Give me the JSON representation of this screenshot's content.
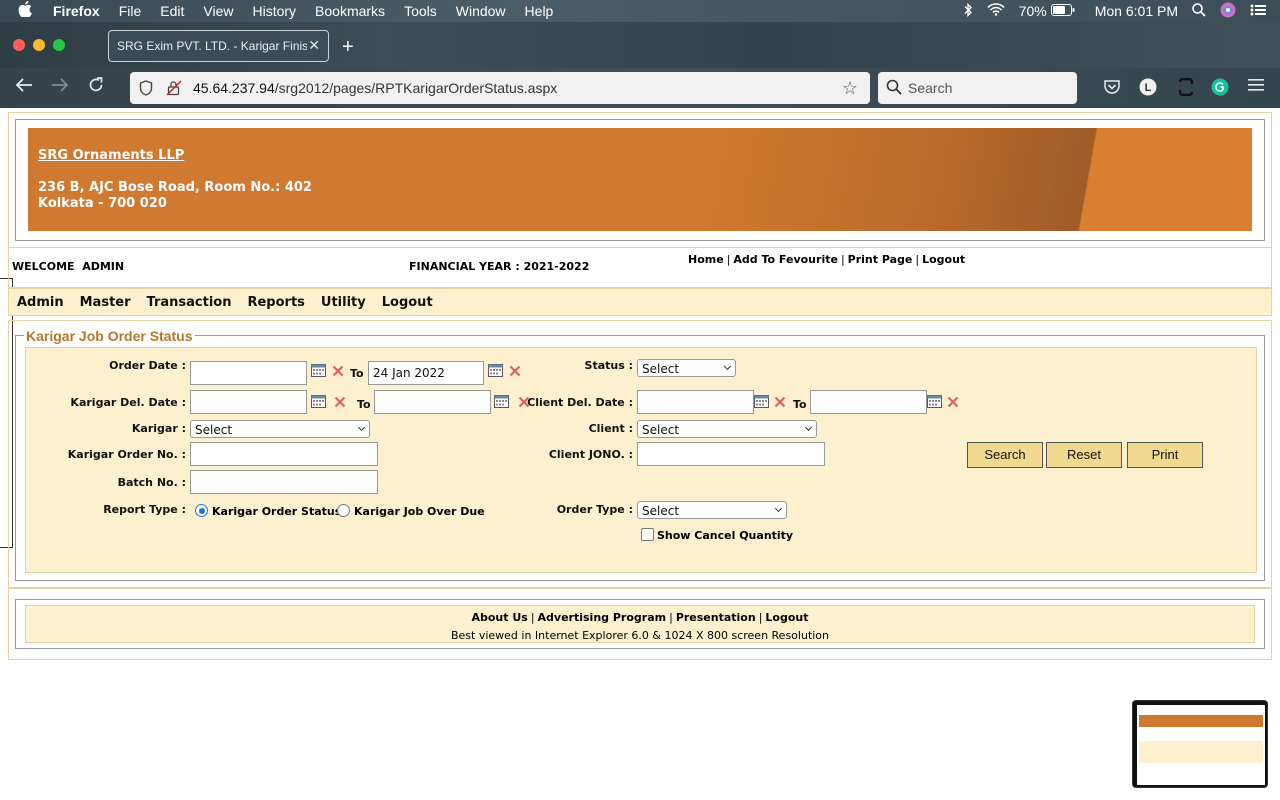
{
  "menubar": {
    "app": "Firefox",
    "items": [
      "File",
      "Edit",
      "View",
      "History",
      "Bookmarks",
      "Tools",
      "Window",
      "Help"
    ],
    "battery": "70%",
    "clock": "Mon 6:01 PM"
  },
  "browser": {
    "tab_title": "SRG Exim PVT. LTD. - Karigar Finish",
    "url_host": "45.64.237.94",
    "url_path": "/srg2012/pages/RPTKarigarOrderStatus.aspx",
    "search_placeholder": "Search",
    "profile_initial": "L"
  },
  "header": {
    "company": "SRG Ornaments LLP",
    "address_line1": "236 B, AJC Bose Road, Room No.: 402",
    "address_line2": "Kolkata - 700 020"
  },
  "info": {
    "welcome": "WELCOME  ADMIN",
    "financial_year": "FINANCIAL YEAR : 2021-2022",
    "links": [
      "Home",
      "Add To Fevourite",
      "Print Page",
      "Logout"
    ]
  },
  "mainmenu": [
    "Admin",
    "Master",
    "Transaction",
    "Reports",
    "Utility",
    "Logout"
  ],
  "form": {
    "legend": "Karigar Job Order Status",
    "order_date_label": "Order Date :",
    "to_label": "To",
    "order_date_from": "",
    "order_date_to": "24 Jan 2022",
    "status_label": "Status :",
    "status_value": "Select",
    "karigar_del_date_label": "Karigar Del. Date :",
    "client_del_date_label": "Client Del. Date :",
    "karigar_label": "Karigar :",
    "karigar_value": "Select",
    "client_label": "Client :",
    "client_value": "Select",
    "karigar_order_no_label": "Karigar Order No. :",
    "client_jono_label": "Client JONO. :",
    "batch_no_label": "Batch No. :",
    "report_type_label": "Report Type :",
    "report_type_options": [
      "Karigar Order Status",
      "Karigar Job Over Due"
    ],
    "report_type_selected": "Karigar Order Status",
    "order_type_label": "Order Type :",
    "order_type_value": "Select",
    "show_cancel_label": "Show Cancel Quantity",
    "show_cancel_checked": false,
    "search_button": "Search",
    "reset_button": "Reset",
    "print_button": "Print"
  },
  "footer": {
    "links": [
      "About Us",
      "Advertising Program",
      "Presentation",
      "Logout"
    ],
    "note": "Best viewed in Internet Explorer 6.0 & 1024 X 800 screen Resolution"
  },
  "colors": {
    "banner": "#cf7a30",
    "panel": "#fdf0cf",
    "legend": "#b5772a",
    "button": "#f1d98f"
  }
}
